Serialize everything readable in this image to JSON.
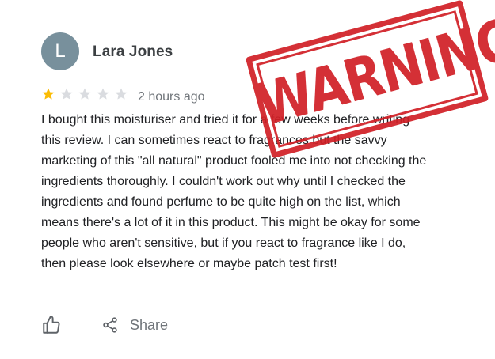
{
  "reviewer": {
    "initial": "L",
    "name": "Lara Jones",
    "avatar_color": "#78909c"
  },
  "rating": {
    "value": 1,
    "max": 5,
    "filled_color": "#fbbc04",
    "empty_color": "#dadce0"
  },
  "timestamp": "2 hours ago",
  "review_text": "I bought this moisturiser and tried it for a few weeks before writing this review. I can sometimes react to fragrances but the savvy marketing of this \"all natural\" product fooled me into not checking the ingredients thoroughly. I couldn't work out why until I checked the ingredients and found perfume to be quite high on the list, which means there's a lot of it in this product. This might be okay for some people who aren't sensitive, but if you react to fragrance like I do, then please look elsewhere or maybe patch test first!",
  "actions": {
    "like_icon": "thumbs-up-icon",
    "share_icon": "share-icon",
    "share_label": "Share"
  },
  "stamp": {
    "text": "WARNING",
    "color": "#d11f26"
  }
}
